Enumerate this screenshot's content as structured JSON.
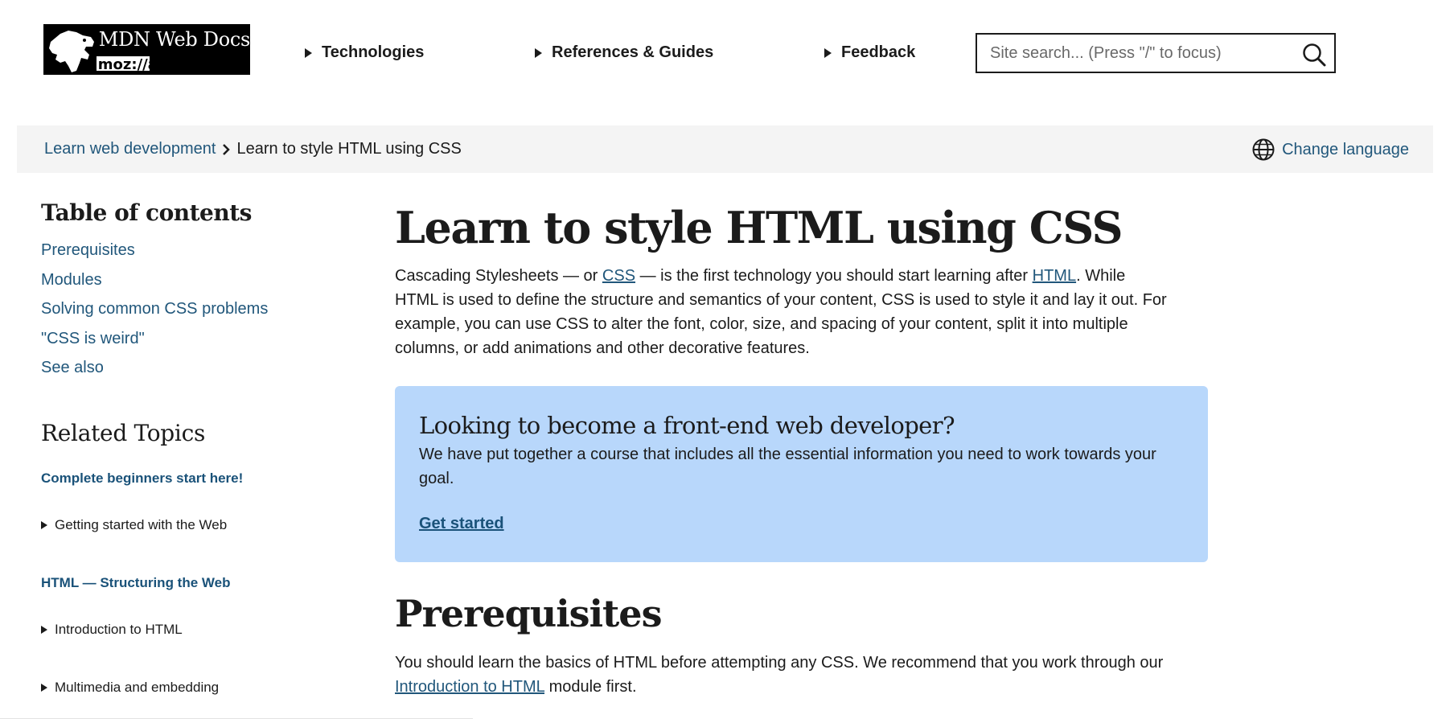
{
  "header": {
    "logo_title": "MDN Web Docs",
    "logo_sub": "moz://a",
    "nav": [
      {
        "label": "Technologies"
      },
      {
        "label": "References & Guides"
      },
      {
        "label": "Feedback"
      }
    ],
    "search_placeholder": "Site search... (Press \"/\" to focus)"
  },
  "breadcrumb": {
    "parent": "Learn web development",
    "current": "Learn to style HTML using CSS",
    "change_language": "Change language"
  },
  "sidebar": {
    "toc_title": "Table of contents",
    "toc": [
      "Prerequisites",
      "Modules",
      "Solving common CSS problems",
      "\"CSS is weird\"",
      "See also"
    ],
    "related_title": "Related Topics",
    "related": {
      "group1": "Complete beginners start here!",
      "item1": "Getting started with the Web",
      "group2": "HTML — Structuring the Web",
      "item2": "Introduction to HTML",
      "item3": "Multimedia and embedding"
    }
  },
  "main": {
    "title": "Learn to style HTML using CSS",
    "intro": {
      "p1": "Cascading Stylesheets — or ",
      "link_css": "CSS",
      "p2": " — is the first technology you should start learning after ",
      "link_html": "HTML",
      "p3": ". While HTML is used to define the structure and semantics of your content, CSS is used to style it and lay it out. For example, you can use CSS to alter the font, color, size, and spacing of your content, split it into multiple columns, or add animations and other decorative features."
    },
    "callout": {
      "title": "Looking to become a front-end web developer?",
      "text": "We have put together a course that includes all the essential information you need to work towards your goal.",
      "link": "Get started"
    },
    "prereq_title": "Prerequisites",
    "prereq": {
      "p1": "You should learn the basics of HTML before attempting any CSS. We recommend that you work through our ",
      "link": "Introduction to HTML",
      "p2": " module first."
    }
  },
  "colors": {
    "link": "#21577b",
    "callout_bg": "#b8d7fb",
    "breadcrumb_bg": "#f4f4f4"
  }
}
